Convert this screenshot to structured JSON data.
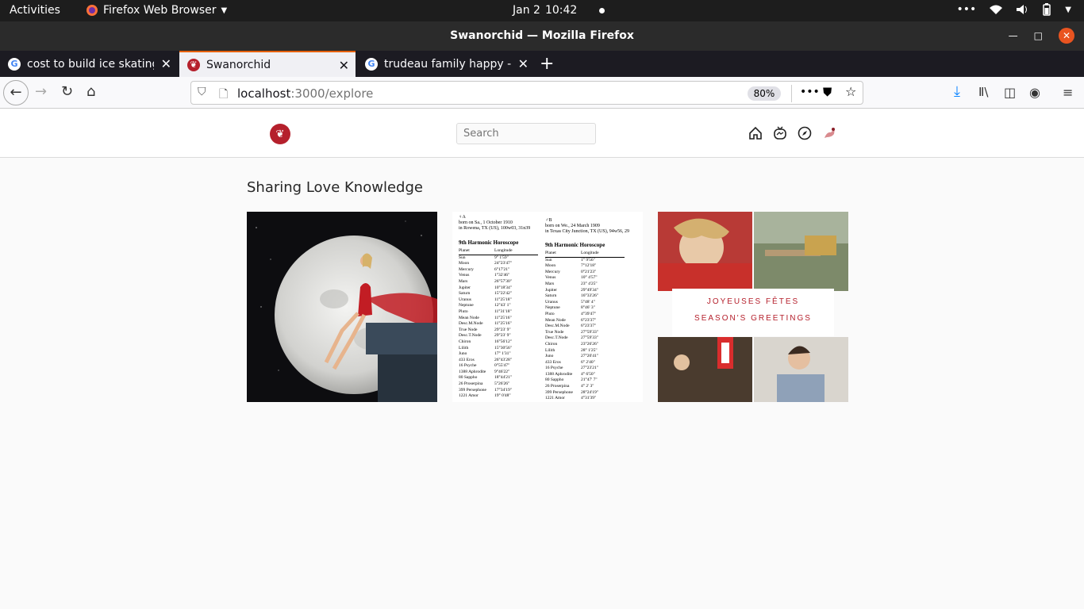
{
  "system": {
    "activities": "Activities",
    "app_name": "Firefox Web Browser",
    "date": "Jan 2",
    "time": "10:42"
  },
  "window": {
    "title": "Swanorchid — Mozilla Firefox"
  },
  "tabs": [
    {
      "label": "cost to build ice skating r"
    },
    {
      "label": "Swanorchid"
    },
    {
      "label": "trudeau family happy - G"
    }
  ],
  "nav": {
    "url_host": "localhost",
    "url_path": ":3000/explore",
    "zoom": "80%"
  },
  "app": {
    "search_placeholder": "Search",
    "section_title": "Sharing Love Knowledge",
    "posts": [
      {
        "alt": "moon"
      },
      {
        "alt": "horoscope",
        "left_header": [
          "born on Sa., 1 October 1910",
          "in Rowena, TX (US), 100w03, 31n39"
        ],
        "right_header": [
          "born on We., 24 March 1909",
          "in Texas City Junction, TX (US), 94w56, 29"
        ],
        "table_title": "9th Harmonic Horoscope",
        "col_planet": "Planet",
        "col_long": "Longitude",
        "rows_left": [
          "Sun",
          "Moon",
          "Mercury",
          "Venus",
          "Mars",
          "Jupiter",
          "Saturn",
          "Uranus",
          "Neptune",
          "Pluto",
          "Mean Node",
          "Desc.M.Node",
          "True Node",
          "Desc.T.Node",
          "Chiron",
          "Lilith",
          "Juno",
          "433 Eros",
          "16 Psyche",
          "1388 Aphrodite",
          "80 Sappho",
          "26 Proserpina",
          "399 Persephone",
          "1221 Amor"
        ],
        "rows_left_vals": [
          "9° 1'59\"",
          "24°23'47\"",
          "6°17'21\"",
          "1°32'46\"",
          "26°57'30\"",
          "10°18'34\"",
          "15°22'42\"",
          "11°25'18\"",
          "12°43' 1\"",
          "11°31'18\"",
          "11°25'16\"",
          "11°25'16\"",
          "29°23' 9\"",
          "29°23' 9\"",
          "16°56'12\"",
          "15°30'56\"",
          "17° 1'31\"",
          "26°43'28\"",
          "0°55'47\"",
          "9°46'22\"",
          "18°44'21\"",
          "5°26'26\"",
          "17°34'19\"",
          "19° 0'48\""
        ],
        "rows_right_vals": [
          "1° 9'56\"",
          "7°12'18\"",
          "0°21'23\"",
          "10° 4'57\"",
          "23° 4'25\"",
          "29°49'34\"",
          "16°33'26\"",
          "5°48' 4\"",
          "8°46' 3\"",
          "4°39'47\"",
          "6°23'37\"",
          "6°23'37\"",
          "27°59'33\"",
          "27°59'33\"",
          "23°26'26\"",
          "28° 1'25\"",
          "27°20'41\"",
          "6° 2'40\"",
          "27°23'21\"",
          "4° 6'50\"",
          "21°47' 7\"",
          "4° 2' 3\"",
          "28°24'19\"",
          "4°31'39\""
        ]
      },
      {
        "alt": "family",
        "line1": "JOYEUSES FÊTES",
        "line2": "SEASON'S GREETINGS"
      }
    ]
  },
  "colors": {
    "accent": "#b5202c",
    "tab_accent": "#e66000"
  }
}
